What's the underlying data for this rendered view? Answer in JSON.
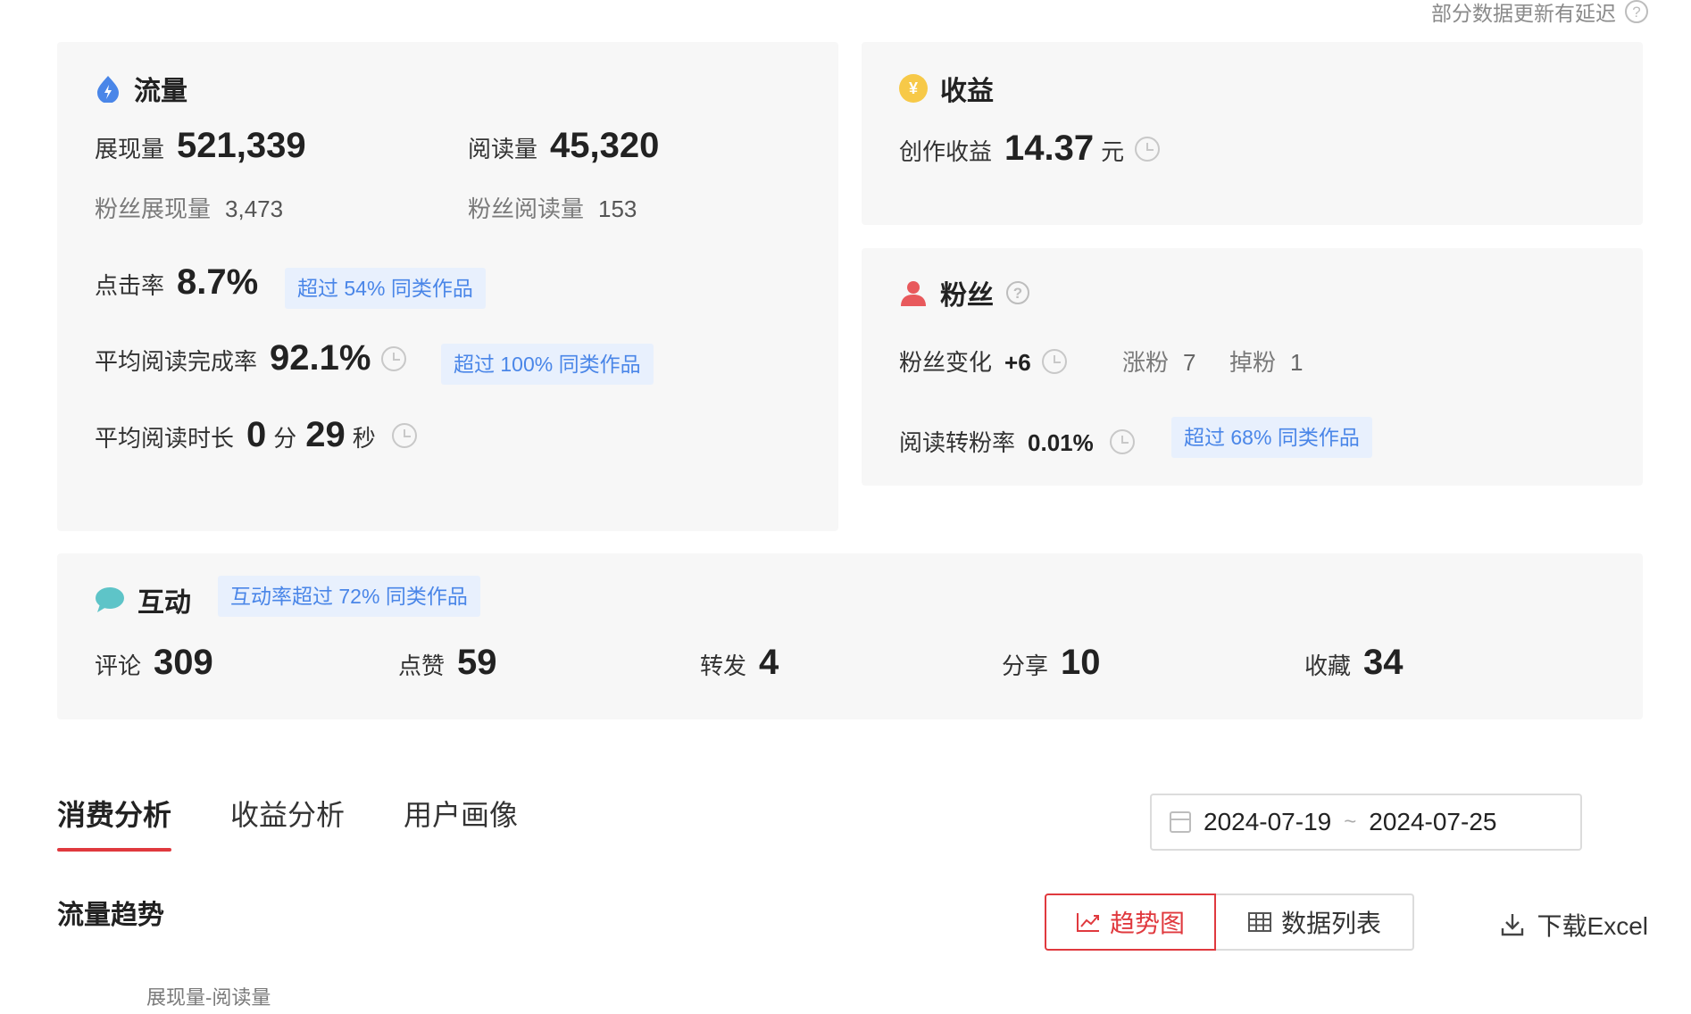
{
  "notice": {
    "text": "部分数据更新有延迟"
  },
  "traffic": {
    "title": "流量",
    "impressions_label": "展现量",
    "impressions_value": "521,339",
    "reads_label": "阅读量",
    "reads_value": "45,320",
    "fan_impressions_label": "粉丝展现量",
    "fan_impressions_value": "3,473",
    "fan_reads_label": "粉丝阅读量",
    "fan_reads_value": "153",
    "ctr_label": "点击率",
    "ctr_value": "8.7%",
    "ctr_tag": "超过 54% 同类作品",
    "completion_label": "平均阅读完成率",
    "completion_value": "92.1%",
    "completion_tag": "超过 100% 同类作品",
    "duration_label": "平均阅读时长",
    "duration_min": "0",
    "duration_min_unit": "分",
    "duration_sec": "29",
    "duration_sec_unit": "秒"
  },
  "income": {
    "title": "收益",
    "creation_label": "创作收益",
    "creation_value": "14.37",
    "creation_unit": "元"
  },
  "fans": {
    "title": "粉丝",
    "change_label": "粉丝变化",
    "change_value": "+6",
    "gain_label": "涨粉",
    "gain_value": "7",
    "loss_label": "掉粉",
    "loss_value": "1",
    "conversion_label": "阅读转粉率",
    "conversion_value": "0.01%",
    "conversion_tag": "超过 68% 同类作品"
  },
  "interaction": {
    "title": "互动",
    "tag": "互动率超过 72% 同类作品",
    "items": [
      {
        "label": "评论",
        "value": "309"
      },
      {
        "label": "点赞",
        "value": "59"
      },
      {
        "label": "转发",
        "value": "4"
      },
      {
        "label": "分享",
        "value": "10"
      },
      {
        "label": "收藏",
        "value": "34"
      }
    ]
  },
  "tabs": [
    {
      "label": "消费分析",
      "active": true
    },
    {
      "label": "收益分析",
      "active": false
    },
    {
      "label": "用户画像",
      "active": false
    }
  ],
  "date_range": {
    "start": "2024-07-19",
    "separator": "~",
    "end": "2024-07-25"
  },
  "trend": {
    "title": "流量趋势",
    "view_trend": "趋势图",
    "view_table": "数据列表",
    "download": "下载Excel",
    "chart_label": "展现量-阅读量"
  },
  "colors": {
    "accent_red": "#e0393e",
    "tag_blue": "#4a86e8",
    "traffic_icon": "#4a86e8",
    "income_icon": "#f7c948",
    "fans_icon": "#e8595c",
    "interaction_icon": "#5ec4c8"
  }
}
